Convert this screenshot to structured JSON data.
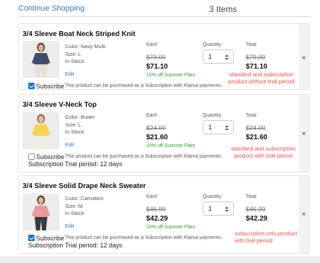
{
  "header": {
    "continue_label": "Continue Shopping",
    "items_count": "3 Items"
  },
  "columns": {
    "each": "Each",
    "quantity": "Quantity",
    "total": "Total"
  },
  "edit_label": "Edit",
  "remove_glyph": "×",
  "subscribe_label": "Subscribe",
  "subscribe_desc": "This product can be purchased as a Subscription with Klarna payments.",
  "items": [
    {
      "title": "3/4 Sleeve Boat Neck Striped Knit",
      "color": "Color: Navy Multi",
      "size": "Size: L",
      "stock": "In Stock",
      "original_price": "$79.00",
      "price": "$71.10",
      "promo": "10% off Summer Flats",
      "quantity": "1",
      "total_original": "$79.00",
      "total": "$71.10",
      "subscribe_checked": true,
      "trial": "",
      "note_line1": "standard and subscription",
      "note_line2": "product without trial period",
      "image_colors": {
        "top": "#3f4b6b",
        "pants": "#e8e2d6",
        "skin": "#d9b39a",
        "hair": "#5a3b28"
      }
    },
    {
      "title": "3/4 Sleeve V-Neck Top",
      "color": "Color: Butter",
      "size": "Size: L",
      "stock": "In Stock",
      "original_price": "$24.00",
      "price": "$21.60",
      "promo": "10% off Summer Flats",
      "quantity": "1",
      "total_original": "$24.00",
      "total": "$21.60",
      "subscribe_checked": false,
      "trial": "Subscription Trial period: 12 days",
      "note_line1": "standard and subscription",
      "note_line2": "product with trial period",
      "image_colors": {
        "top": "#f3d35c",
        "pants": "#f0ede4",
        "skin": "#e2bea2",
        "hair": "#8a6a3a"
      }
    },
    {
      "title": "3/4 Sleeve Solid Drape Neck Sweater",
      "color": "Color: Carnation",
      "size": "Size: M",
      "stock": "In Stock",
      "original_price": "$46.99",
      "price": "$42.29",
      "promo": "10% off Summer Flats",
      "quantity": "1",
      "total_original": "$46.99",
      "total": "$42.29",
      "subscribe_checked": true,
      "trial": "Subscription Trial period: 12 days",
      "note_line1": "subscription only product",
      "note_line2": "with trial period",
      "image_colors": {
        "top": "#e79aa0",
        "pants": "#3a3a40",
        "skin": "#deb49a",
        "hair": "#4a2f1f"
      }
    }
  ]
}
